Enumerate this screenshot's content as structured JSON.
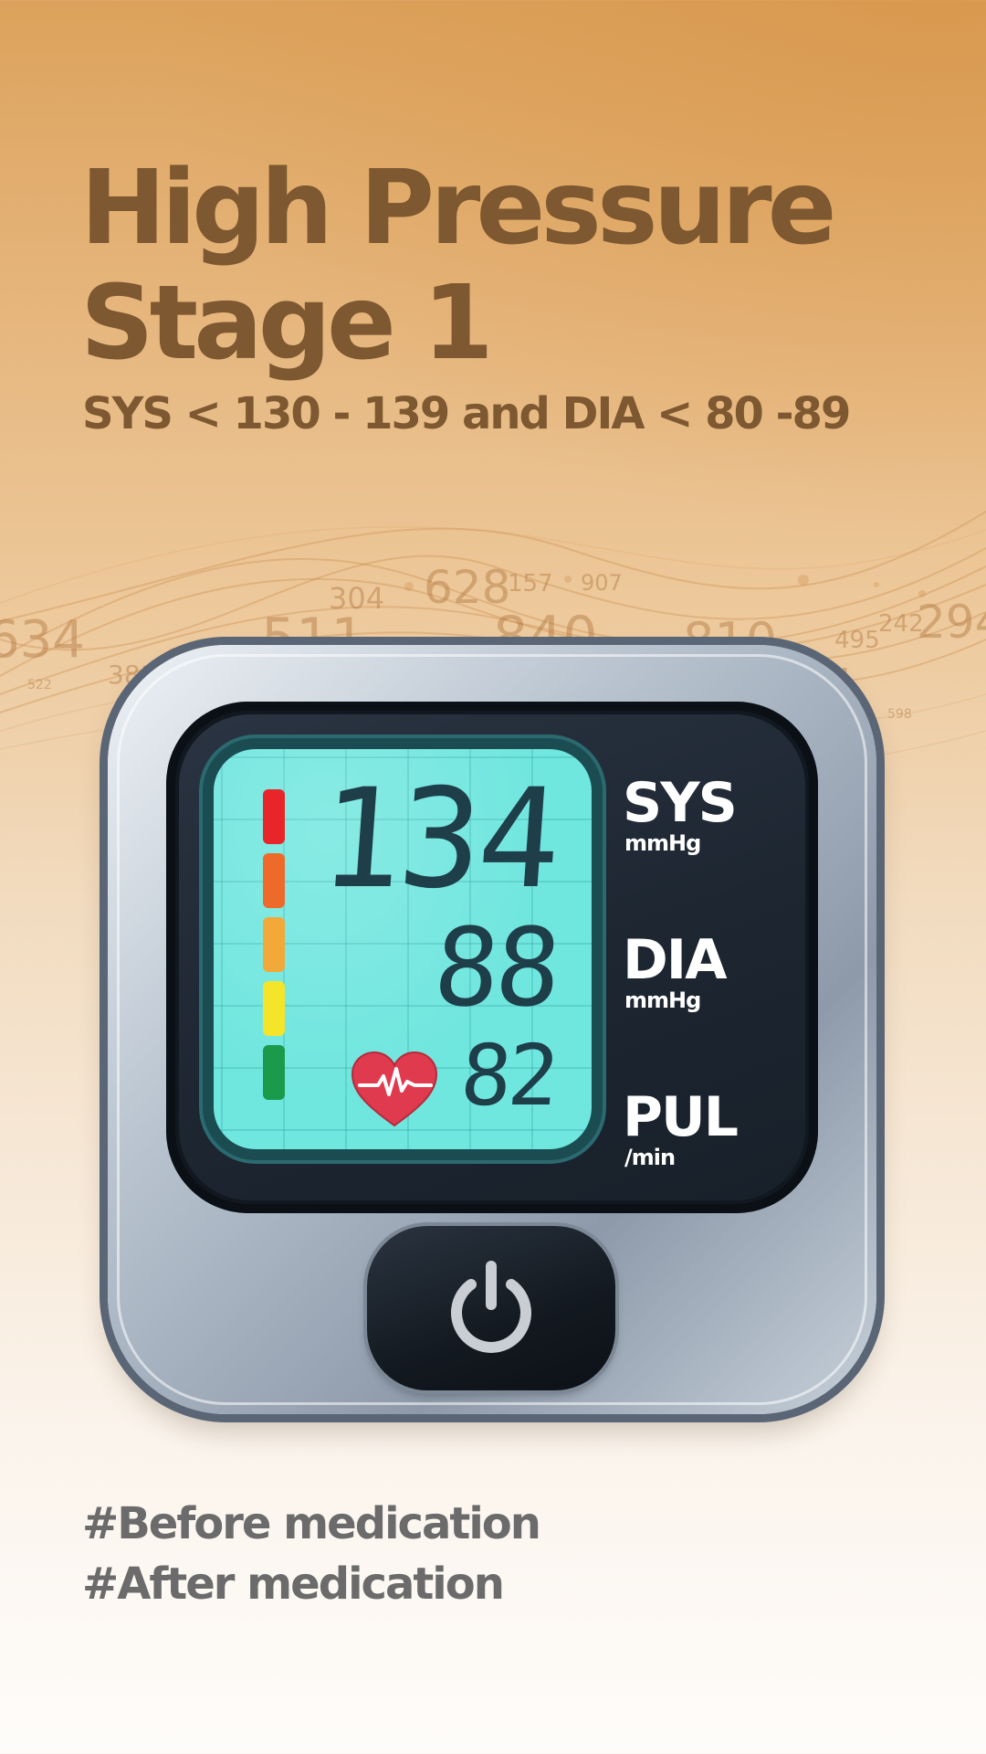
{
  "headline": {
    "line1": "High Pressure",
    "line2": "Stage 1"
  },
  "range_text": "SYS < 130 - 139 and DIA < 80 -89",
  "background_numbers": [
    "304",
    "628",
    "157",
    "907",
    "511",
    "840",
    "810",
    "495",
    "242",
    "294",
    "634",
    "381",
    "598",
    "522",
    "94"
  ],
  "monitor": {
    "sys_value": "134",
    "dia_value": "88",
    "pul_value": "82",
    "sys_label": "SYS",
    "sys_unit": "mmHg",
    "dia_label": "DIA",
    "dia_unit": "mmHg",
    "pul_label": "PUL",
    "pul_unit": "/min",
    "level_colors": [
      "#e8262a",
      "#ee6a2a",
      "#f3a83a",
      "#f4e52a",
      "#1a9a4a"
    ],
    "heart_icon": "heart-pulse-icon",
    "power_icon": "power-icon"
  },
  "tags": {
    "tag1": "#Before medication",
    "tag2": "#After medication"
  },
  "colors": {
    "headline": "#7d5830",
    "lcd": "#6fe6de",
    "panel": "#121820",
    "tag_text": "#6b6b6b"
  }
}
